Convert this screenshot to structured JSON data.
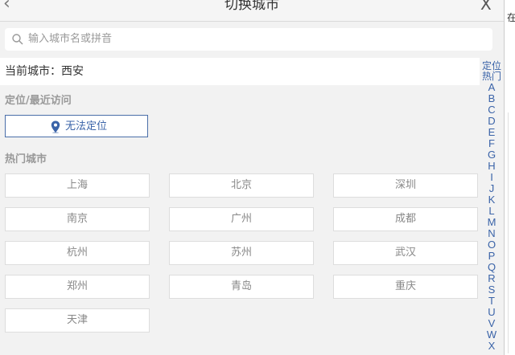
{
  "header": {
    "title": "切换城市",
    "back_icon": "chevron-left-icon",
    "close_label": "X"
  },
  "search": {
    "placeholder": "输入城市名或拼音",
    "icon": "search-icon"
  },
  "current_city": {
    "label": "当前城市：西安"
  },
  "location_section": {
    "title": "定位/最近访问",
    "locate_button": "无法定位",
    "icon": "location-pin-icon"
  },
  "hot_section": {
    "title": "热门城市"
  },
  "hot_cities": [
    {
      "name": "上海"
    },
    {
      "name": "北京"
    },
    {
      "name": "深圳"
    },
    {
      "name": "南京"
    },
    {
      "name": "广州"
    },
    {
      "name": "成都"
    },
    {
      "name": "杭州"
    },
    {
      "name": "苏州"
    },
    {
      "name": "武汉"
    },
    {
      "name": "郑州"
    },
    {
      "name": "青岛"
    },
    {
      "name": "重庆"
    },
    {
      "name": "天津"
    }
  ],
  "index_bar": {
    "words": [
      "定位",
      "热门"
    ],
    "letters": [
      "A",
      "B",
      "C",
      "D",
      "E",
      "F",
      "G",
      "H",
      "I",
      "J",
      "K",
      "L",
      "M",
      "N",
      "O",
      "P",
      "Q",
      "R",
      "S",
      "T",
      "U",
      "V",
      "W",
      "X"
    ]
  },
  "side_window": {
    "text": "在"
  },
  "colors": {
    "accent": "#3a63a8",
    "border": "#dddddd",
    "bg": "#f2f2f2"
  }
}
